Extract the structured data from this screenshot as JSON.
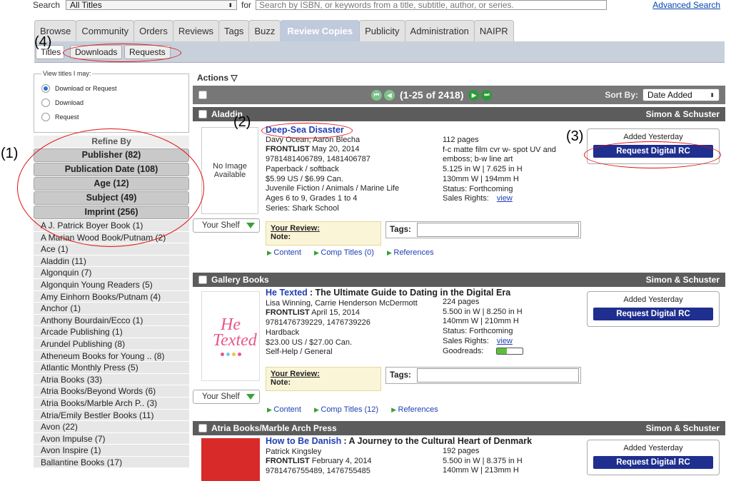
{
  "top": {
    "search_label": "Search",
    "search_scope": "All Titles",
    "for_label": "for",
    "search_placeholder": "Search by ISBN, or keywords from a title, subtitle, author, or series.",
    "advanced_search": "Advanced Search"
  },
  "tabs": [
    "Browse",
    "Community",
    "Orders",
    "Reviews",
    "Tags",
    "Buzz",
    "Review Copies",
    "Publicity",
    "Administration",
    "NAIPR"
  ],
  "active_tab": "Review Copies",
  "subtabs": {
    "titles": "Titles",
    "downloads": "Downloads",
    "requests": "Requests"
  },
  "annotations": {
    "a1": "(1)",
    "a2": "(2)",
    "a3": "(3)",
    "a4": "(4)"
  },
  "view_titles": {
    "legend": "View titles I may:",
    "options": [
      "Download or Request",
      "Download",
      "Request"
    ],
    "selected": "Download or Request"
  },
  "refine": {
    "title": "Refine By",
    "facets": [
      "Publisher (82)",
      "Publication Date (108)",
      "Age (12)",
      "Subject (49)",
      "Imprint (256)"
    ],
    "imprints": [
      "A J. Patrick Boyer Book (1)",
      "A Marian Wood Book/Putnam (2)",
      "Ace (1)",
      "Aladdin (11)",
      "Algonquin (7)",
      "Algonquin Young Readers (5)",
      "Amy Einhorn Books/Putnam (4)",
      "Anchor (1)",
      "Anthony Bourdain/Ecco (1)",
      "Arcade Publishing (1)",
      "Arundel Publishing (8)",
      "Atheneum Books for Young .. (8)",
      "Atlantic Monthly Press (5)",
      "Atria Books (33)",
      "Atria Books/Beyond Words (6)",
      "Atria Books/Marble Arch P.. (3)",
      "Atria/Emily Bestler Books (11)",
      "Avon (22)",
      "Avon Impulse (7)",
      "Avon Inspire (1)",
      "Ballantine Books (17)"
    ]
  },
  "list": {
    "actions_label": "Actions ▽",
    "range": "(1-25 of 2418)",
    "sort_label": "Sort By:",
    "sort_value": "Date Added"
  },
  "books": [
    {
      "imprint": "Aladdin",
      "publisher": "Simon & Schuster",
      "title": "Deep-Sea Disaster",
      "subtitle": "",
      "no_image": "No Image Available",
      "authors": "Davy Ocean, Aaron Blecha",
      "frontlist": "FRONTLIST",
      "date": "May 20, 2014",
      "isbn": "9781481406789, 1481406787",
      "format": "Paperback / softback",
      "price": "$5.99 US / $6.99 Can.",
      "category": "Juvenile Fiction / Animals / Marine Life",
      "ages": "Ages 6 to 9, Grades 1 to 4",
      "series": "Series: Shark School",
      "pages": "112 pages",
      "extra1": "f-c matte film cvr w- spot UV and",
      "extra2": "emboss; b-w line art",
      "inches": "5.125 in W | 7.625 in H",
      "mm": "130mm W | 194mm H",
      "status": "Status: Forthcoming",
      "sales_rights": "Sales Rights:",
      "view": "view",
      "added": "Added Yesterday",
      "request": "Request Digital RC",
      "comp": "Comp Titles (0)"
    },
    {
      "imprint": "Gallery Books",
      "publisher": "Simon & Schuster",
      "title": "He Texted",
      "subtitle": ": The Ultimate Guide to Dating in the Digital Era",
      "authors": "Lisa Winning, Carrie Henderson McDermott",
      "frontlist": "FRONTLIST",
      "date": "April 15, 2014",
      "isbn": "9781476739229, 1476739226",
      "format": "Hardback",
      "price": "$23.00 US / $27.00 Can.",
      "category": "Self-Help / General",
      "pages": "224 pages",
      "inches": "5.500 in W | 8.250 in H",
      "mm": "140mm W | 210mm H",
      "status": "Status: Forthcoming",
      "sales_rights": "Sales Rights:",
      "view": "view",
      "goodreads": "Goodreads:",
      "goodreads_level": 0.4,
      "added": "Added Yesterday",
      "request": "Request Digital RC",
      "comp": "Comp Titles (12)"
    },
    {
      "imprint": "Atria Books/Marble Arch Press",
      "publisher": "Simon & Schuster",
      "title": "How to Be Danish",
      "subtitle": ": A Journey to the Cultural Heart of Denmark",
      "authors": "Patrick Kingsley",
      "frontlist": "FRONTLIST",
      "date": "February 4, 2014",
      "isbn": "9781476755489, 1476755485",
      "pages": "192 pages",
      "inches": "5.500 in W | 8.375 in H",
      "mm": "140mm W | 213mm H",
      "added": "Added Yesterday",
      "request": "Request Digital RC"
    }
  ],
  "common": {
    "your_shelf": "Your Shelf",
    "your_review": "Your Review:",
    "note": "Note:",
    "tags": "Tags:",
    "content": "Content",
    "references": "References",
    "cover_text": "He Texted"
  },
  "colors": {
    "accent_blue": "#1f2f8f",
    "annotation_red": "#e01010",
    "active_tab": "#bfcbdc",
    "bar_fill": "#5ac03a"
  }
}
